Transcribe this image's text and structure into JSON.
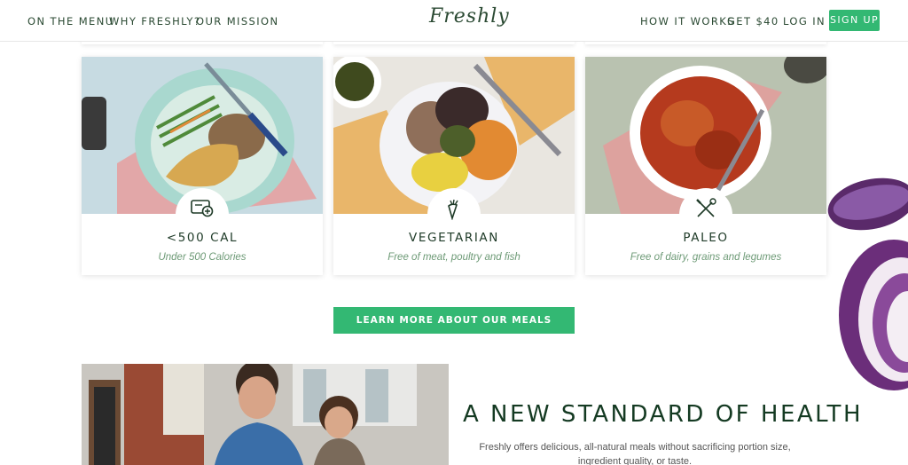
{
  "nav": {
    "left_links": [
      "ON THE MENU",
      "WHY FRESHLY?",
      "OUR MISSION"
    ],
    "logo": "Freshly",
    "right_links": [
      "HOW IT WORKS",
      "GET $40",
      "LOG IN"
    ],
    "signup": "SIGN UP"
  },
  "cards": [
    {
      "title": "<500 CAL",
      "subtitle": "Under 500 Calories",
      "icon": "scale-icon"
    },
    {
      "title": "VEGETARIAN",
      "subtitle": "Free of meat, poultry and fish",
      "icon": "carrot-icon"
    },
    {
      "title": "PALEO",
      "subtitle": "Free of dairy, grains and legumes",
      "icon": "crossed-tools-icon"
    }
  ],
  "cta": "LEARN MORE ABOUT OUR MEALS",
  "section": {
    "headline": "A NEW STANDARD OF HEALTH",
    "body": "Freshly offers delicious, all-natural meals without sacrificing portion size, ingredient quality, or taste."
  },
  "colors": {
    "accent": "#33b873",
    "text_dark": "#1e3a27",
    "subtitle": "#6d9a76"
  }
}
